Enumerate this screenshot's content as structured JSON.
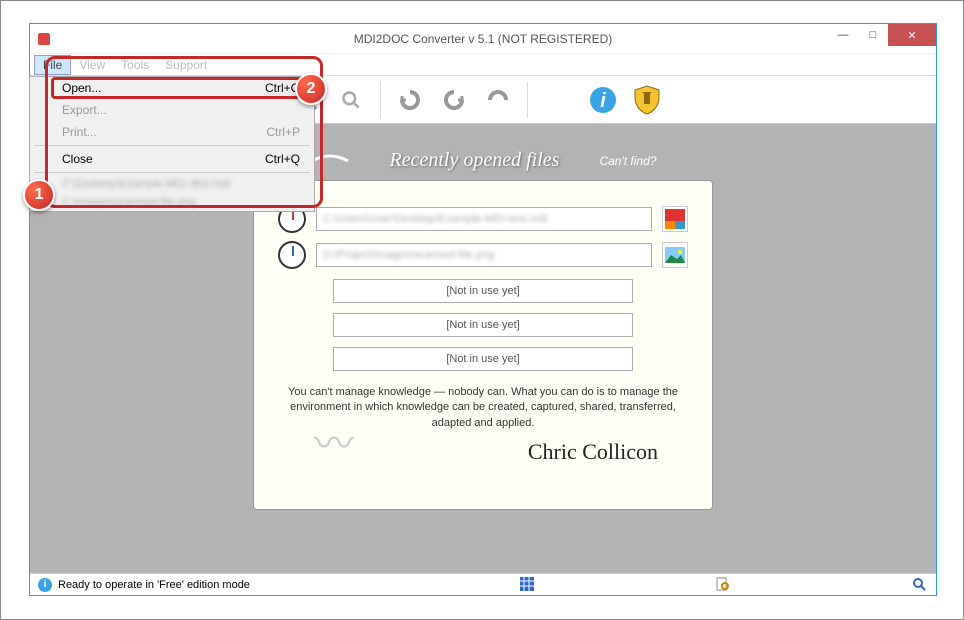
{
  "window": {
    "title": "MDI2DOC Converter v 5.1   (NOT REGISTERED)"
  },
  "menubar": {
    "file": "File",
    "view": "View",
    "tools": "Tools",
    "support": "Support"
  },
  "file_menu": {
    "open": {
      "label": "Open...",
      "shortcut": "Ctrl+O"
    },
    "export": {
      "label": "Export...",
      "shortcut": ""
    },
    "print": {
      "label": "Print...",
      "shortcut": "Ctrl+P"
    },
    "close": {
      "label": "Close",
      "shortcut": "Ctrl+Q"
    },
    "recent1": "C:\\Desktop\\Example-MDI-djvu.mdi",
    "recent2": "C:\\Images\\scanned-file.png"
  },
  "panel": {
    "title": "Recently opened files",
    "cant_find": "Can't find?",
    "file1": "C:\\Users\\User\\Desktop\\Example-MDI-test.mdi",
    "file2": "D:\\Project\\Images\\scanned-file.png",
    "slot": "[Not in use yet]",
    "quote": "You can't manage knowledge — nobody can. What you can do is to manage the environment in which knowledge can be created, captured, shared, transferred, adapted and applied.",
    "signature": "Chric Collicon"
  },
  "statusbar": {
    "text": "Ready to operate in 'Free' edition mode"
  },
  "callouts": {
    "n1": "1",
    "n2": "2"
  }
}
